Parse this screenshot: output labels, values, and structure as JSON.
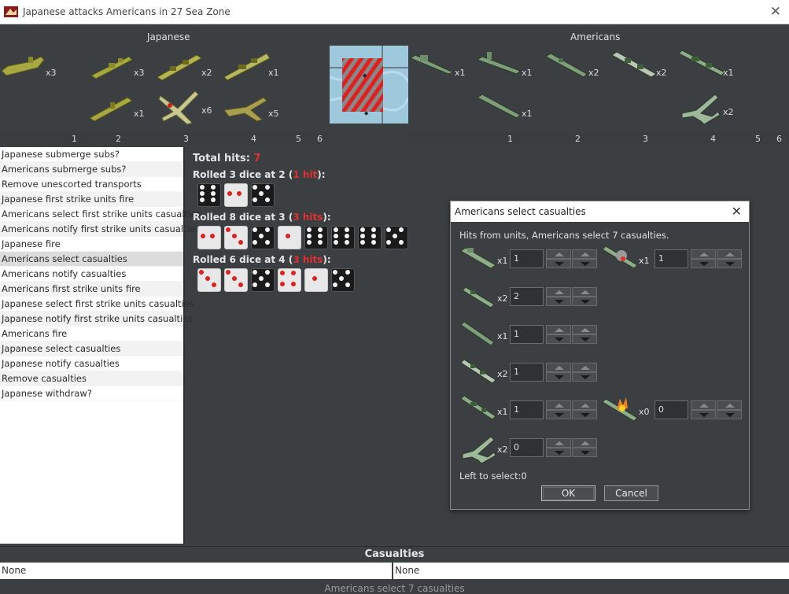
{
  "window": {
    "title": "Japanese attacks Americans in 27 Sea Zone"
  },
  "sides": {
    "attacker": "Japanese",
    "defender": "Americans"
  },
  "attacker_units": [
    {
      "icon": "submarine-icon",
      "count": "x3"
    },
    {
      "icon": "destroyer-icon",
      "count": "x3"
    },
    {
      "icon": "cruiser-icon",
      "count": "x2"
    },
    {
      "icon": "battleship-icon",
      "count": "x1"
    },
    {
      "icon": "transport-icon",
      "count": "x1"
    },
    {
      "icon": "fighter-icon",
      "count": "x6"
    },
    {
      "icon": "bomber-icon",
      "count": "x5"
    }
  ],
  "defender_units": [
    {
      "icon": "transport-icon",
      "count": "x1"
    },
    {
      "icon": "submarine-icon",
      "count": "x1"
    },
    {
      "icon": "destroyer-icon",
      "count": "x2"
    },
    {
      "icon": "cruiser-icon",
      "count": "x2"
    },
    {
      "icon": "battleship-icon",
      "count": "x1"
    },
    {
      "icon": "submarine-icon",
      "count": "x1"
    },
    {
      "icon": "fighter-icon",
      "count": "x2"
    }
  ],
  "columns": [
    "1",
    "2",
    "3",
    "4",
    "5",
    "6"
  ],
  "steps": [
    "Japanese submerge subs?",
    "Americans submerge subs?",
    "Remove unescorted transports",
    "Japanese first strike units fire",
    "Americans select first strike units casualties",
    "Americans notify first strike units casualties",
    "Japanese fire",
    "Americans select casualties",
    "Americans notify casualties",
    "Americans first strike units fire",
    "Japanese select first strike units casualties",
    "Japanese notify first strike units casualties",
    "Americans fire",
    "Japanese select casualties",
    "Japanese notify casualties",
    "Remove casualties",
    "Japanese withdraw?"
  ],
  "selected_step": "Americans select casualties",
  "dice": {
    "total_label": "Total hits: ",
    "total_value": "7",
    "rolls": [
      {
        "pre": "Rolled 3 dice at 2 (",
        "hits": "1 hit",
        "post": "):",
        "faces": [
          6,
          2,
          5
        ]
      },
      {
        "pre": "Rolled 8 dice at 3 (",
        "hits": "3 hits",
        "post": "):",
        "faces": [
          2,
          3,
          5,
          1,
          6,
          6,
          6,
          5
        ]
      },
      {
        "pre": "Rolled 6 dice at 4 (",
        "hits": "3 hits",
        "post": "):",
        "faces": [
          3,
          3,
          5,
          4,
          1,
          5
        ]
      }
    ]
  },
  "dialog": {
    "title": "Americans select casualties",
    "hits_text": "Hits from units,  Americans select 7 casualties.",
    "items": [
      {
        "icon": "transport-icon",
        "count": "x1",
        "value": "1"
      },
      {
        "icon": "damaged-battleship-icon",
        "count": "x1",
        "value": "1"
      },
      {
        "icon": "destroyer-icon",
        "count": "x2",
        "value": "2"
      },
      {
        "icon": "submarine-icon",
        "count": "x1",
        "value": "1"
      },
      {
        "icon": "cruiser-icon",
        "count": "x2",
        "value": "1"
      },
      {
        "icon": "battleship-icon",
        "count": "x1",
        "value": "1"
      },
      {
        "icon": "burning-battleship-icon",
        "count": "x0",
        "value": "0"
      },
      {
        "icon": "fighter-icon",
        "count": "x2",
        "value": "0"
      }
    ],
    "left_to_select": "Left to select:0",
    "ok_label": "OK",
    "cancel_label": "Cancel"
  },
  "casualties": {
    "title": "Casualties",
    "attacker": "None",
    "defender": "None"
  },
  "status": "Americans select 7 casualties",
  "colors": {
    "hit_red": "#e03030",
    "jap_unit": "#a8a840",
    "us_unit": "#6e8e6a",
    "sea": "#9ec8dc"
  }
}
